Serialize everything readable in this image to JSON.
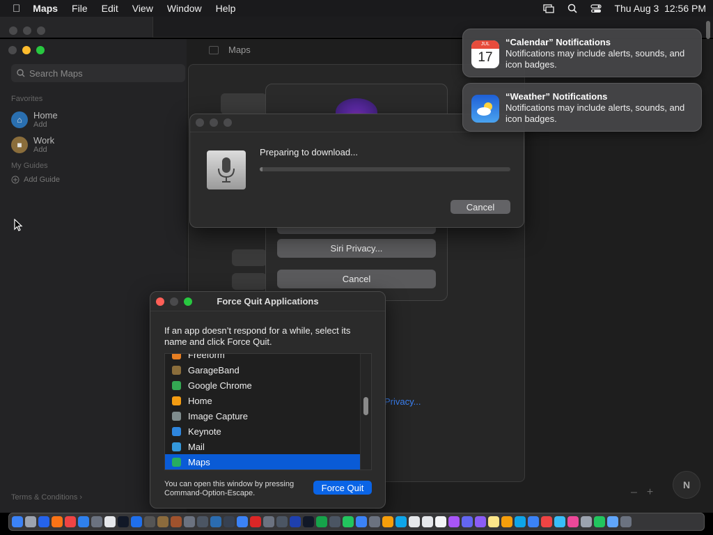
{
  "menubar": {
    "app": "Maps",
    "items": [
      "File",
      "Edit",
      "View",
      "Window",
      "Help"
    ],
    "datetime": "Thu Aug 3  12:56 PM"
  },
  "maps": {
    "window_title": "Maps",
    "search_placeholder": "Search Maps",
    "favorites_heading": "Favorites",
    "favorites": [
      {
        "name": "Home",
        "sub": "Add"
      },
      {
        "name": "Work",
        "sub": "Add"
      }
    ],
    "guides_heading": "My Guides",
    "add_guide": "Add Guide",
    "terms": "Terms & Conditions",
    "privacy_link": "Privacy..."
  },
  "siri_sheet": {
    "privacy_button": "Siri Privacy...",
    "cancel_button": "Cancel"
  },
  "download_dialog": {
    "status": "Preparing to download...",
    "progress": 0.01,
    "cancel": "Cancel"
  },
  "force_quit": {
    "title": "Force Quit Applications",
    "description": "If an app doesn’t respond for a while, select its name and click Force Quit.",
    "apps": [
      {
        "name": "Freeform",
        "color": "#e67e22"
      },
      {
        "name": "GarageBand",
        "color": "#8a6d3b"
      },
      {
        "name": "Google Chrome",
        "color": "#34a853"
      },
      {
        "name": "Home",
        "color": "#f39c12"
      },
      {
        "name": "Image Capture",
        "color": "#7f8c8d"
      },
      {
        "name": "Keynote",
        "color": "#2e86de"
      },
      {
        "name": "Mail",
        "color": "#3498db"
      },
      {
        "name": "Maps",
        "color": "#27ae60"
      }
    ],
    "selected": "Maps",
    "hint": "You can open this window by pressing Command-Option-Escape.",
    "button": "Force Quit"
  },
  "notifications": [
    {
      "title": "“Calendar” Notifications",
      "body": "Notifications may include alerts, sounds, and icon badges.",
      "icon": "calendar-icon",
      "month": "JUL",
      "day": "17"
    },
    {
      "title": "“Weather” Notifications",
      "body": "Notifications may include alerts, sounds, and icon badges.",
      "icon": "weather-icon"
    }
  ],
  "map_controls": {
    "compass": "N",
    "zoom_out": "–",
    "zoom_in": "+"
  },
  "dock": {
    "colors": [
      "#3b82f6",
      "#9ca3af",
      "#2563eb",
      "#f97316",
      "#ef4444",
      "#2f80ed",
      "#6b7280",
      "#e5e7eb",
      "#111827",
      "#1f6feb",
      "#555",
      "#8b6b3d",
      "#a0522d",
      "#6b7280",
      "#4b5563",
      "#2b6cb0",
      "#374151",
      "#3b82f6",
      "#dc2626",
      "#6b7280",
      "#4b5563",
      "#1e40af",
      "#111827",
      "#16a34a",
      "#4b5563",
      "#22c55e",
      "#3b82f6",
      "#6b7280",
      "#f59e0b",
      "#0ea5e9",
      "#e5e7eb",
      "#e5e7eb",
      "#f3f4f6",
      "#a855f7",
      "#6366f1",
      "#8b5cf6",
      "#fde68a",
      "#f59e0b",
      "#0ea5e9",
      "#3b82f6",
      "#ef4444",
      "#38bdf8",
      "#ec4899",
      "#9ca3af",
      "#22c55e",
      "#60a5fa",
      "#6b7280"
    ]
  }
}
